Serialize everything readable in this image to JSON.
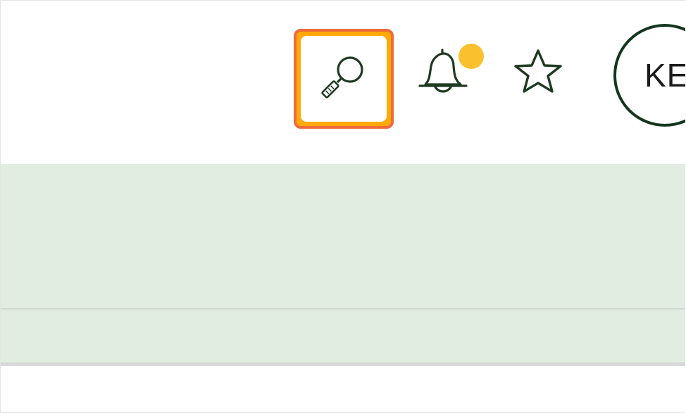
{
  "header": {
    "search_icon": "magnifier-search-icon",
    "notifications_icon": "bell-icon",
    "notification_badge_color": "#fbc02d",
    "favorites_icon": "star-icon",
    "avatar": {
      "initials": "KE",
      "border_color": "#14361d"
    },
    "highlight": {
      "fill_color": "#ffa90a",
      "border_color": "#ef6b3c"
    }
  },
  "band": {
    "background": "#e2ede2"
  }
}
